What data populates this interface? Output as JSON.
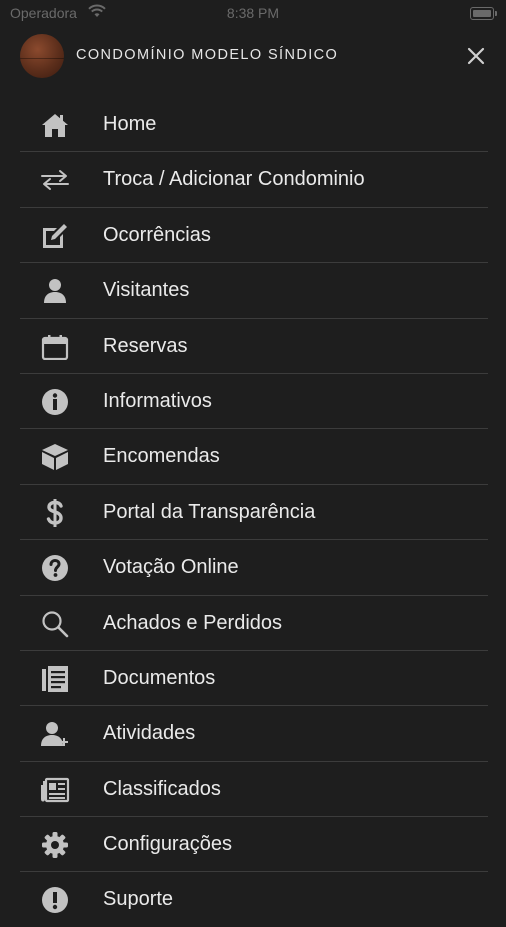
{
  "status_bar": {
    "carrier": "Operadora",
    "time": "8:38 PM"
  },
  "header": {
    "condominium_name": "CONDOMÍNIO MODELO SÍNDICO"
  },
  "menu": {
    "items": [
      {
        "label": "Home",
        "icon": "home-icon"
      },
      {
        "label": "Troca / Adicionar Condominio",
        "icon": "swap-icon"
      },
      {
        "label": "Ocorrências",
        "icon": "edit-icon"
      },
      {
        "label": "Visitantes",
        "icon": "person-icon"
      },
      {
        "label": "Reservas",
        "icon": "calendar-icon"
      },
      {
        "label": "Informativos",
        "icon": "info-icon"
      },
      {
        "label": "Encomendas",
        "icon": "package-icon"
      },
      {
        "label": "Portal da Transparência",
        "icon": "dollar-icon"
      },
      {
        "label": "Votação Online",
        "icon": "question-icon"
      },
      {
        "label": "Achados e Perdidos",
        "icon": "search-icon"
      },
      {
        "label": "Documentos",
        "icon": "document-icon"
      },
      {
        "label": "Atividades",
        "icon": "person-plus-icon"
      },
      {
        "label": "Classificados",
        "icon": "newspaper-icon"
      },
      {
        "label": "Configurações",
        "icon": "gear-icon"
      },
      {
        "label": "Suporte",
        "icon": "support-icon"
      }
    ]
  },
  "colors": {
    "background": "#1e1e1e",
    "text": "#eaeaea",
    "icon": "#c2c2c2",
    "divider": "#3c3c3c"
  }
}
